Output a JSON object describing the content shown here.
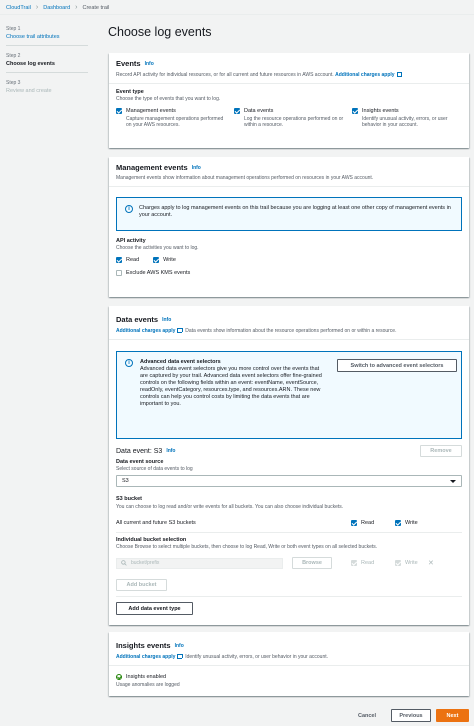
{
  "breadcrumb": {
    "items": [
      "CloudTrail",
      "Dashboard"
    ],
    "current": "Create trail"
  },
  "steps": [
    {
      "num": "Step 1",
      "label": "Choose trail attributes",
      "state": "link"
    },
    {
      "num": "Step 2",
      "label": "Choose log events",
      "state": "active"
    },
    {
      "num": "Step 3",
      "label": "Review and create",
      "state": "disabled"
    }
  ],
  "page_title": "Choose log events",
  "events": {
    "title": "Events",
    "info": "Info",
    "desc": "Record API activity for individual resources, or for all current and future resources in AWS account.",
    "charges_link": "Additional charges apply",
    "type_label": "Event type",
    "type_desc": "Choose the type of events that you want to log.",
    "options": [
      {
        "label": "Management events",
        "desc": "Capture management operations performed on your AWS resources."
      },
      {
        "label": "Data events",
        "desc": "Log the resource operations performed on or within a resource."
      },
      {
        "label": "Insights events",
        "desc": "Identify unusual activity, errors, or user behavior in your account."
      }
    ]
  },
  "mgmt": {
    "title": "Management events",
    "info": "Info",
    "desc": "Management events show information about management operations performed on resources in your AWS account.",
    "flash": "Charges apply to log management events on this trail because you are logging at least one other copy of management events in your account.",
    "api_label": "API activity",
    "api_desc": "Choose the activities you want to log.",
    "read": "Read",
    "write": "Write",
    "exclude_kms": "Exclude AWS KMS events"
  },
  "data": {
    "title": "Data events",
    "info": "Info",
    "charges_link": "Additional charges apply",
    "desc": "Data events show information about the resource operations performed on or within a resource.",
    "adv_title": "Advanced data event selectors",
    "adv_body": "Advanced data event selectors give you more control over the events that are captured by your trail. Advanced data event selectors offer fine-grained controls on the following fields within an event: eventName, eventSource, readOnly, eventCategory, resources.type, and resources.ARN. These new controls can help you control costs by limiting the data events that are important to you.",
    "switch_button": "Switch to advanced event selectors",
    "s3_title": "Data event: S3",
    "s3_info": "Info",
    "remove": "Remove",
    "source_label": "Data event source",
    "source_desc": "Select source of data events to log",
    "source_value": "S3",
    "bucket_label": "S3 bucket",
    "bucket_desc": "You can choose to log read and/or write events for all buckets. You can also choose individual buckets.",
    "all_buckets": "All current and future S3 buckets",
    "read": "Read",
    "write": "Write",
    "indiv_label": "Individual bucket selection",
    "indiv_desc": "Choose Browse to select multiple buckets, then choose to log Read, Write or both event types on all selected buckets.",
    "bucket_placeholder": "bucket/prefix",
    "browse": "Browse",
    "add_bucket": "Add bucket",
    "add_type": "Add data event type"
  },
  "insights": {
    "title": "Insights events",
    "info": "Info",
    "charges_link": "Additional charges apply",
    "desc": "Identify unusual activity, errors, or user behavior in your account.",
    "enabled": "Insights enabled",
    "enabled_desc": "Usage anomalies are logged"
  },
  "footer": {
    "cancel": "Cancel",
    "previous": "Previous",
    "next": "Next"
  },
  "colors": {
    "accent": "#0073bb",
    "primary": "#ec7211",
    "success": "#1d8102"
  }
}
